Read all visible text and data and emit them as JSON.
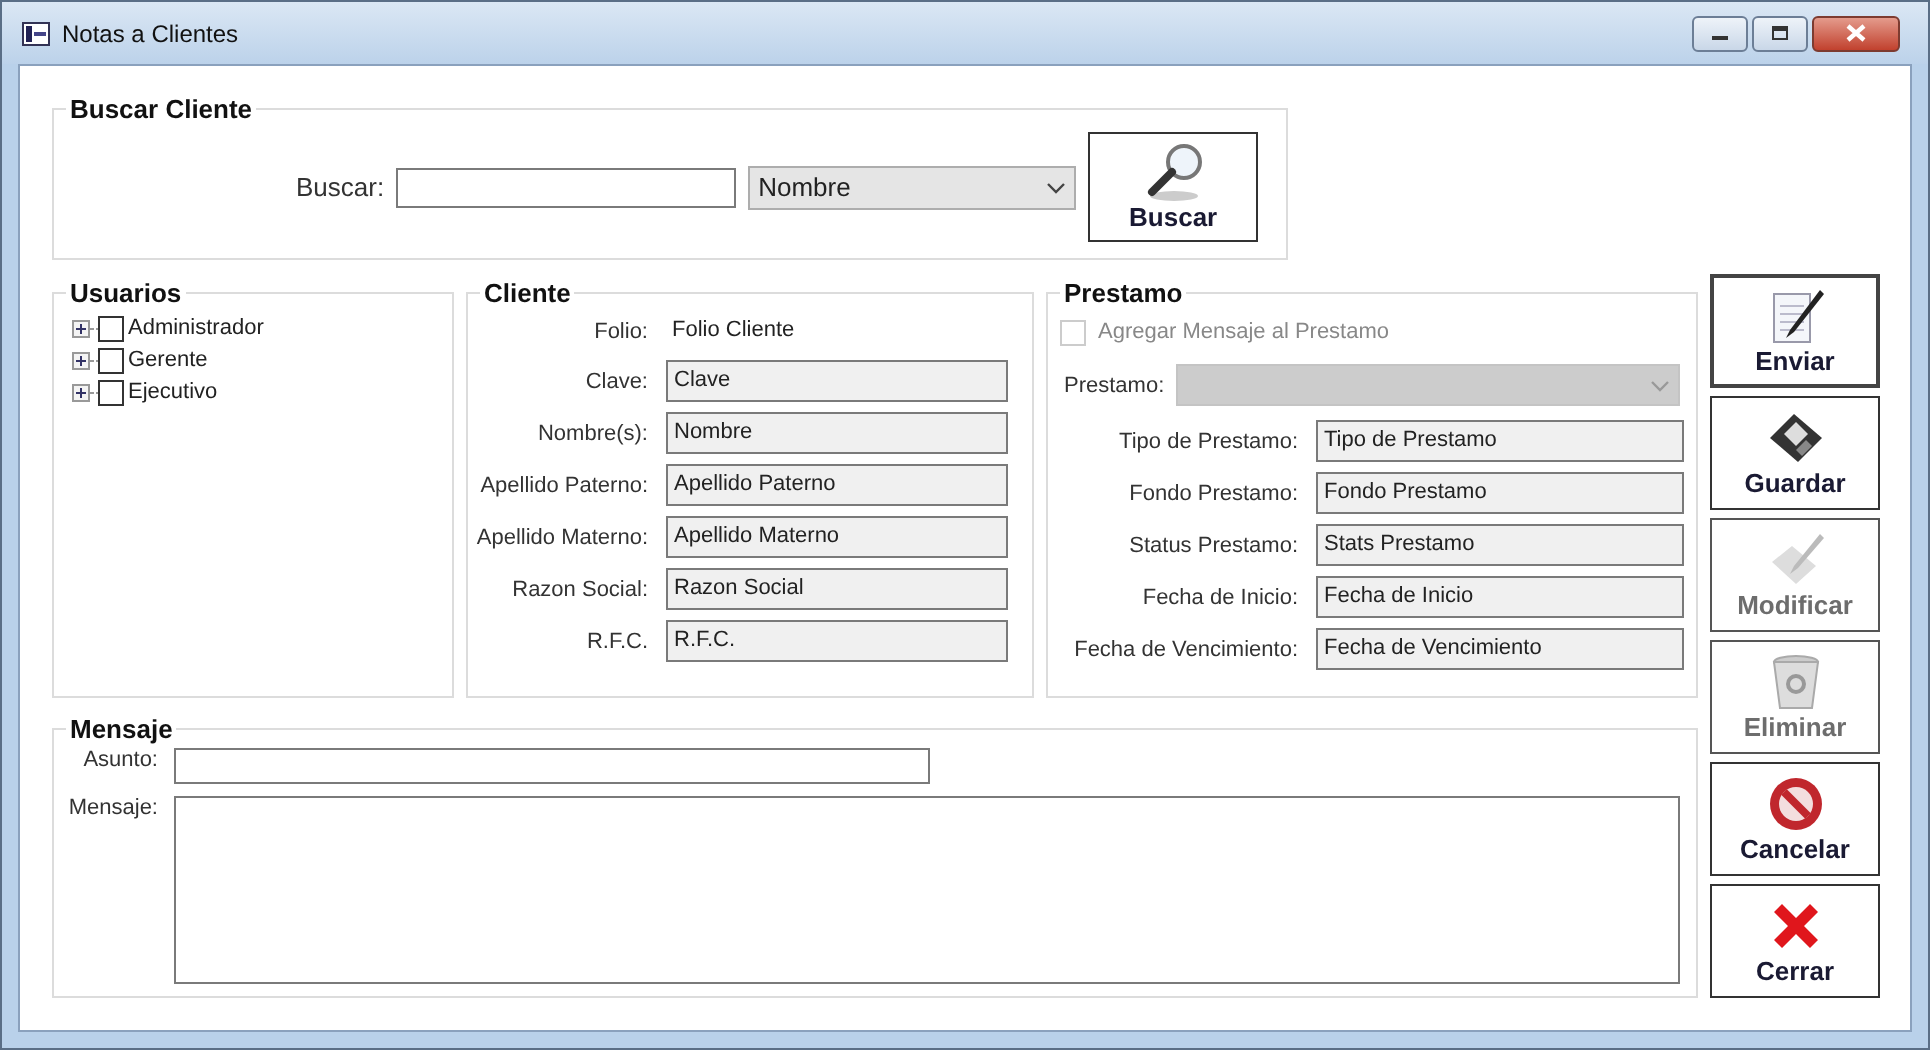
{
  "window": {
    "title": "Notas a Clientes"
  },
  "search_group": {
    "title": "Buscar Cliente",
    "label": "Buscar:",
    "filter": "Nombre",
    "button": "Buscar"
  },
  "users_group": {
    "title": "Usuarios",
    "items": [
      {
        "label": "Administrador",
        "checked": false,
        "expanded": false
      },
      {
        "label": "Gerente",
        "checked": false,
        "expanded": false
      },
      {
        "label": "Ejecutivo",
        "checked": false,
        "expanded": false
      }
    ]
  },
  "client_group": {
    "title": "Cliente",
    "folio_label": "Folio:",
    "folio_value": "Folio Cliente",
    "fields": [
      {
        "label": "Clave:",
        "value": "Clave"
      },
      {
        "label": "Nombre(s):",
        "value": "Nombre"
      },
      {
        "label": "Apellido Paterno:",
        "value": "Apellido Paterno"
      },
      {
        "label": "Apellido Materno:",
        "value": "Apellido Materno"
      },
      {
        "label": "Razon Social:",
        "value": "Razon Social"
      },
      {
        "label": "R.F.C.",
        "value": "R.F.C."
      }
    ]
  },
  "loan_group": {
    "title": "Prestamo",
    "attach": {
      "label": "Agregar Mensaje al Prestamo",
      "checked": false,
      "disabled": true
    },
    "loan_label": "Prestamo:",
    "loan_disabled": true,
    "fields": [
      {
        "label": "Tipo de Prestamo:",
        "value": "Tipo de Prestamo"
      },
      {
        "label": "Fondo Prestamo:",
        "value": "Fondo Prestamo"
      },
      {
        "label": "Status Prestamo:",
        "value": "Stats Prestamo"
      },
      {
        "label": "Fecha de Inicio:",
        "value": "Fecha de Inicio"
      },
      {
        "label": "Fecha de Vencimiento:",
        "value": "Fecha de Vencimiento"
      }
    ]
  },
  "message_group": {
    "title": "Mensaje",
    "subject_label": "Asunto:",
    "body_label": "Mensaje:"
  },
  "buttons": [
    {
      "label": "Enviar",
      "kind": "send",
      "disabled": false,
      "default": true
    },
    {
      "label": "Guardar",
      "kind": "save",
      "disabled": false,
      "default": false
    },
    {
      "label": "Modificar",
      "kind": "edit",
      "disabled": true,
      "default": false
    },
    {
      "label": "Eliminar",
      "kind": "delete",
      "disabled": true,
      "default": false
    },
    {
      "label": "Cancelar",
      "kind": "cancel",
      "disabled": false,
      "default": false
    },
    {
      "label": "Cerrar",
      "kind": "close",
      "disabled": false,
      "default": false
    }
  ]
}
